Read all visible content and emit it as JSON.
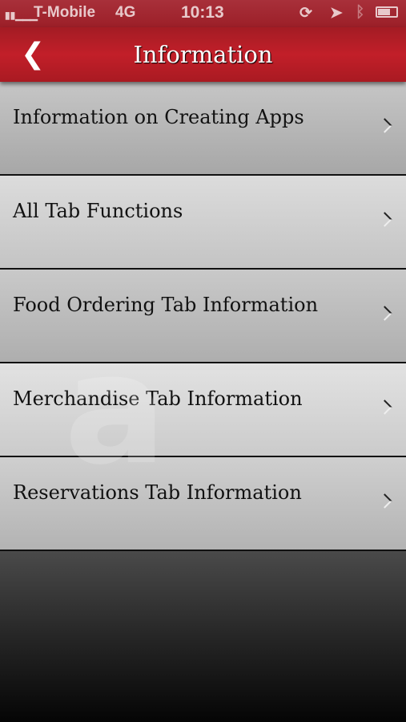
{
  "status_bar": {
    "carrier": "T-Mobile",
    "network": "4G",
    "time": "10:13"
  },
  "nav": {
    "title": "Information",
    "back_icon": "chevron-left"
  },
  "items": [
    {
      "label": "Information on Creating Apps"
    },
    {
      "label": "All Tab Functions"
    },
    {
      "label": "Food Ordering Tab Information"
    },
    {
      "label": "Merchandise Tab Information"
    },
    {
      "label": "Reservations Tab Information"
    }
  ],
  "colors": {
    "accent": "#c21f29"
  }
}
